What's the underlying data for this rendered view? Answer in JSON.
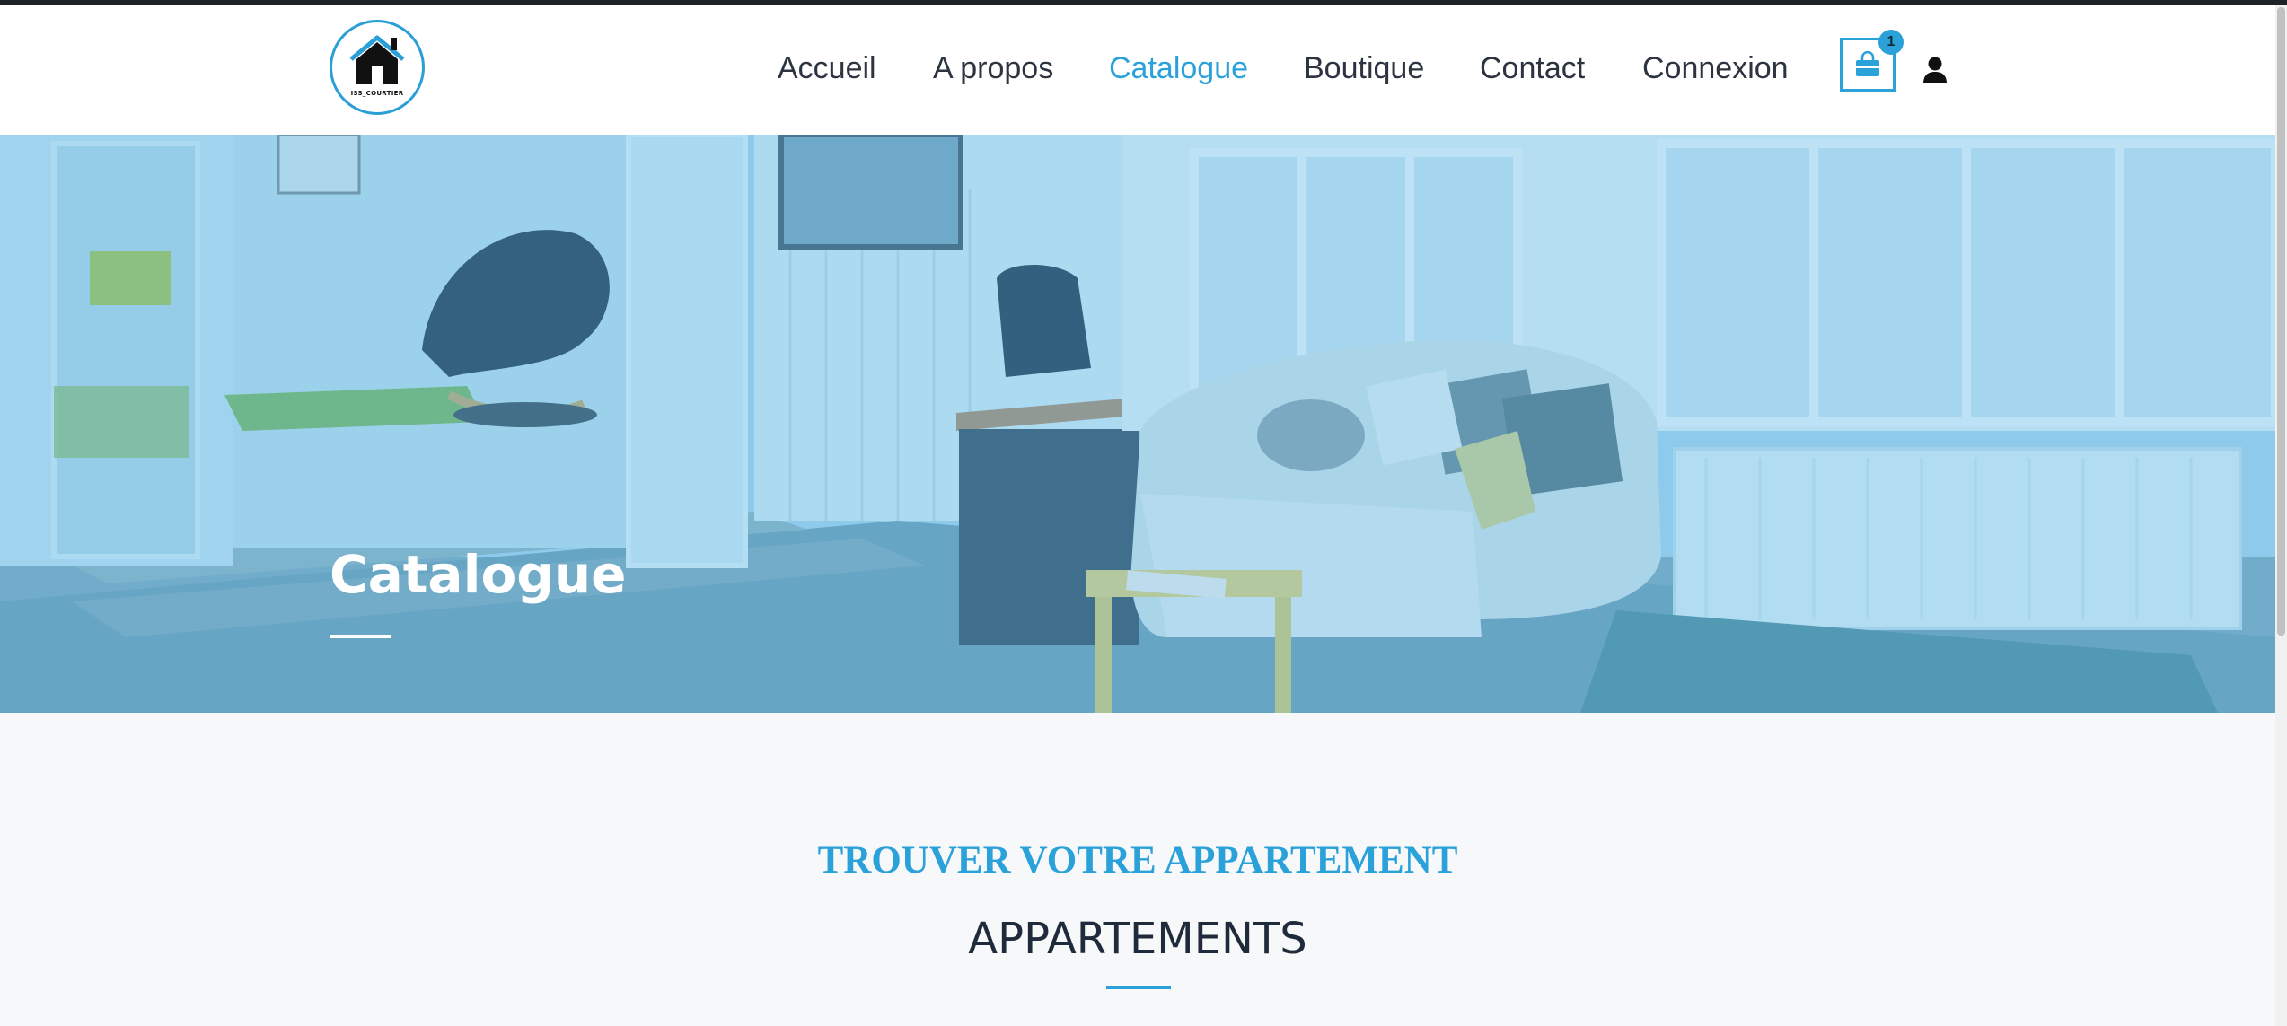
{
  "logo": {
    "text": "ISS_COURTIER",
    "icon": "house-icon"
  },
  "nav": {
    "items": [
      {
        "label": "Accueil"
      },
      {
        "label": "A propos"
      },
      {
        "label": "Catalogue",
        "active": true
      },
      {
        "label": "Boutique"
      },
      {
        "label": "Contact"
      },
      {
        "label": "Connexion"
      }
    ],
    "cart": {
      "icon": "shopping-bag-icon",
      "count": "1"
    },
    "user": {
      "icon": "user-icon"
    }
  },
  "hero": {
    "title": "Catalogue"
  },
  "section": {
    "kicker": "TROUVER VOTRE APPARTEMENT",
    "title": "APPARTEMENTS"
  },
  "colors": {
    "accent": "#2ba1d9",
    "text_dark": "#2b3440",
    "section_bg": "#f7f8fa"
  }
}
